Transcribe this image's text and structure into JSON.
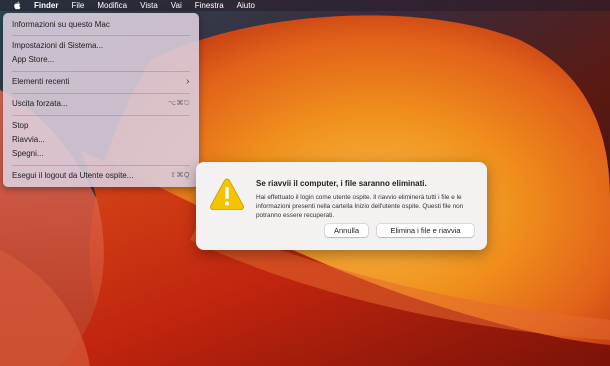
{
  "menubar": {
    "app_name": "Finder",
    "items": [
      "File",
      "Modifica",
      "Vista",
      "Vai",
      "Finestra",
      "Aiuto"
    ]
  },
  "apple_menu": {
    "items": [
      {
        "label": "Informazioni su questo Mac",
        "shortcut": ""
      },
      {
        "label": "Impostazioni di Sistema...",
        "shortcut": ""
      },
      {
        "label": "App Store...",
        "shortcut": ""
      },
      {
        "label": "Elementi recenti",
        "shortcut": "›"
      },
      {
        "label": "Uscita forzata...",
        "shortcut": "⌥⌘⎋"
      },
      {
        "label": "Stop",
        "shortcut": ""
      },
      {
        "label": "Riavvia...",
        "shortcut": ""
      },
      {
        "label": "Spegni...",
        "shortcut": ""
      },
      {
        "label": "Esegui il logout da Utente ospite...",
        "shortcut": "⇧⌘Q"
      }
    ]
  },
  "alert": {
    "icon": "warning-icon",
    "title": "Se riavvii il computer, i file saranno eliminati.",
    "body": "Hai effettuato il login come utente ospite. Il riavvio eliminerà tutti i file e le informazioni presenti nella cartella Inizio dell'utente ospite. Questi file non potranno essere recuperati.",
    "cancel_label": "Annulla",
    "confirm_label": "Elimina i file e riavvia"
  },
  "colors": {
    "wallpaper_orange": "#f39a1c",
    "wallpaper_red": "#b8280f",
    "warning_yellow": "#f5c400"
  }
}
